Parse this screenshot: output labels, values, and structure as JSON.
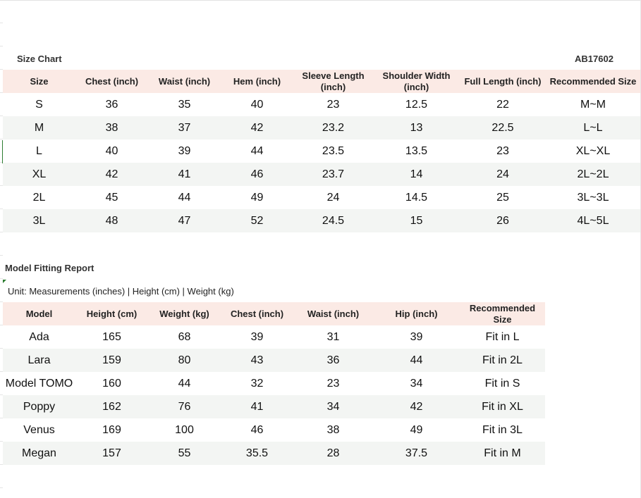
{
  "size_chart": {
    "title": "Size Chart",
    "code": "AB17602",
    "headers": [
      "Size",
      "Chest (inch)",
      "Waist  (inch)",
      "Hem (inch)",
      "Sleeve Length (inch)",
      "Shoulder Width (inch)",
      "Full Length (inch)",
      "Recommended Size"
    ],
    "rows": [
      [
        "S",
        "36",
        "35",
        "40",
        "23",
        "12.5",
        "22",
        "M~M"
      ],
      [
        "M",
        "38",
        "37",
        "42",
        "23.2",
        "13",
        "22.5",
        "L~L"
      ],
      [
        "L",
        "40",
        "39",
        "44",
        "23.5",
        "13.5",
        "23",
        "XL~XL"
      ],
      [
        "XL",
        "42",
        "41",
        "46",
        "23.7",
        "14",
        "24",
        "2L~2L"
      ],
      [
        "2L",
        "45",
        "44",
        "49",
        "24",
        "14.5",
        "25",
        "3L~3L"
      ],
      [
        "3L",
        "48",
        "47",
        "52",
        "24.5",
        "15",
        "26",
        "4L~5L"
      ]
    ]
  },
  "fitting_report": {
    "title": "Model Fitting Report",
    "unit_note": "Unit: Measurements (inches) | Height (cm) | Weight (kg)",
    "headers": [
      "Model",
      "Height (cm)",
      "Weight (kg)",
      "Chest (inch)",
      "Waist (inch)",
      "Hip (inch)",
      "Recommended Size"
    ],
    "rows": [
      [
        "Ada",
        "165",
        "68",
        "39",
        "31",
        "39",
        "Fit in L"
      ],
      [
        "Lara",
        "159",
        "80",
        "43",
        "36",
        "44",
        "Fit in 2L"
      ],
      [
        "Model TOMO",
        "160",
        "44",
        "32",
        "23",
        "34",
        "Fit in S"
      ],
      [
        "Poppy",
        "162",
        "76",
        "41",
        "34",
        "42",
        "Fit in XL"
      ],
      [
        "Venus",
        "169",
        "100",
        "46",
        "38",
        "49",
        "Fit in 3L"
      ],
      [
        "Megan",
        "157",
        "55",
        "35.5",
        "28",
        "37.5",
        "Fit in M"
      ]
    ]
  },
  "colors": {
    "header_bg": "#fbeae5",
    "stripe_bg": "#f3f5f3",
    "selection": "#2e7d32"
  }
}
